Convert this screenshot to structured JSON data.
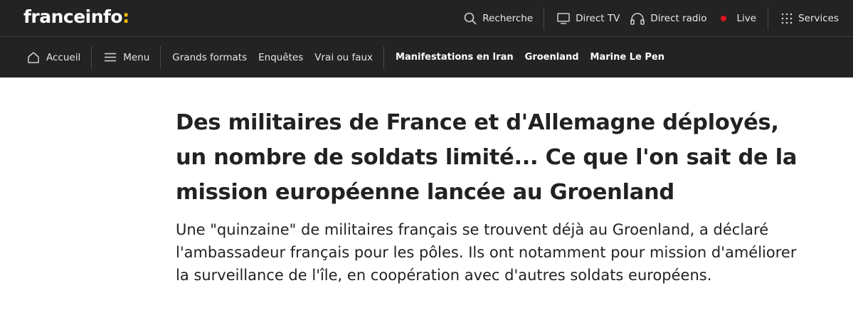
{
  "header": {
    "logo_text": "franceinfo",
    "logo_colon": ":",
    "search_label": "Recherche",
    "direct_tv_label": "Direct TV",
    "direct_radio_label": "Direct radio",
    "live_label": "Live",
    "services_label": "Services"
  },
  "nav": {
    "home_label": "Accueil",
    "menu_label": "Menu",
    "links": [
      "Grands formats",
      "Enquêtes",
      "Vrai ou faux"
    ],
    "topics": [
      "Manifestations en Iran",
      "Groenland",
      "Marine Le Pen"
    ]
  },
  "article": {
    "headline": "Des militaires de France et d'Allemagne déployés, un nombre de soldats limité... Ce que l'on sait de la mission européenne lancée au Groenland",
    "lede": "Une \"quinzaine\" de militaires français se trouvent déjà au Groenland, a déclaré l'ambassadeur français pour les pôles. Ils ont notamment pour mission d'améliorer la surveillance de l'île, en coopération avec d'autres soldats européens."
  },
  "colors": {
    "header_bg": "#232323",
    "accent_yellow": "#fcc000",
    "live_red": "#e0141e",
    "text": "#222222"
  },
  "icons": [
    "search-icon",
    "tv-icon",
    "headphones-icon",
    "live-dot-icon",
    "grid-icon",
    "home-icon",
    "hamburger-icon"
  ]
}
